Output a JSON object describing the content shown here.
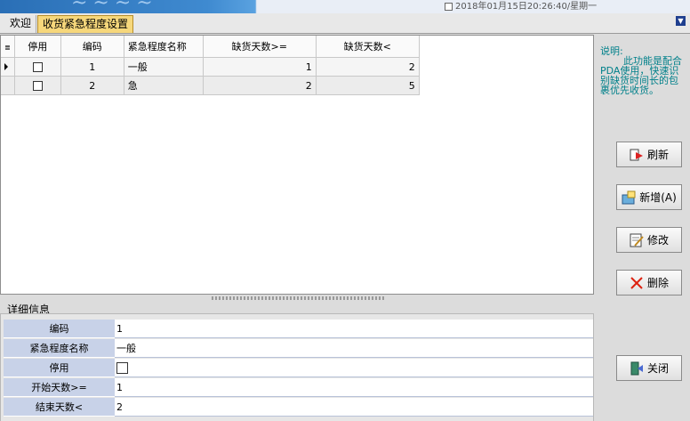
{
  "banner": {
    "datetime": "2018年01月15日20:26:40/星期一",
    "deco": "~~~~"
  },
  "tabs": [
    {
      "label": "欢迎"
    },
    {
      "label": "收货紧急程度设置"
    }
  ],
  "grid": {
    "headers": [
      "停用",
      "编码",
      "紧急程度名称",
      "缺货天数>=",
      "缺货天数<"
    ],
    "rows": [
      {
        "disabled": false,
        "code": "1",
        "name": "一般",
        "min_days": "1",
        "max_days": "2"
      },
      {
        "disabled": false,
        "code": "2",
        "name": "急",
        "min_days": "2",
        "max_days": "5"
      }
    ]
  },
  "detail": {
    "title": "详细信息",
    "fields": [
      {
        "label": "编码",
        "value": "1"
      },
      {
        "label": "紧急程度名称",
        "value": "一般"
      },
      {
        "label": "停用",
        "value": ""
      },
      {
        "label": "开始天数>=",
        "value": "1"
      },
      {
        "label": "结束天数<",
        "value": "2"
      }
    ]
  },
  "help": {
    "title": "说明:",
    "line1": "此功能是配合",
    "line2": "PDA使用，快速识",
    "line3": "别缺货时间长的包",
    "line4": "裹优先收货。"
  },
  "buttons": {
    "refresh": "刷新",
    "add": "新增(A)",
    "edit": "修改",
    "delete": "删除",
    "close": "关闭"
  },
  "colors": {
    "accent": "#f6d77b",
    "help_text": "#00808a",
    "detail_label_bg": "#c8d2e8"
  }
}
